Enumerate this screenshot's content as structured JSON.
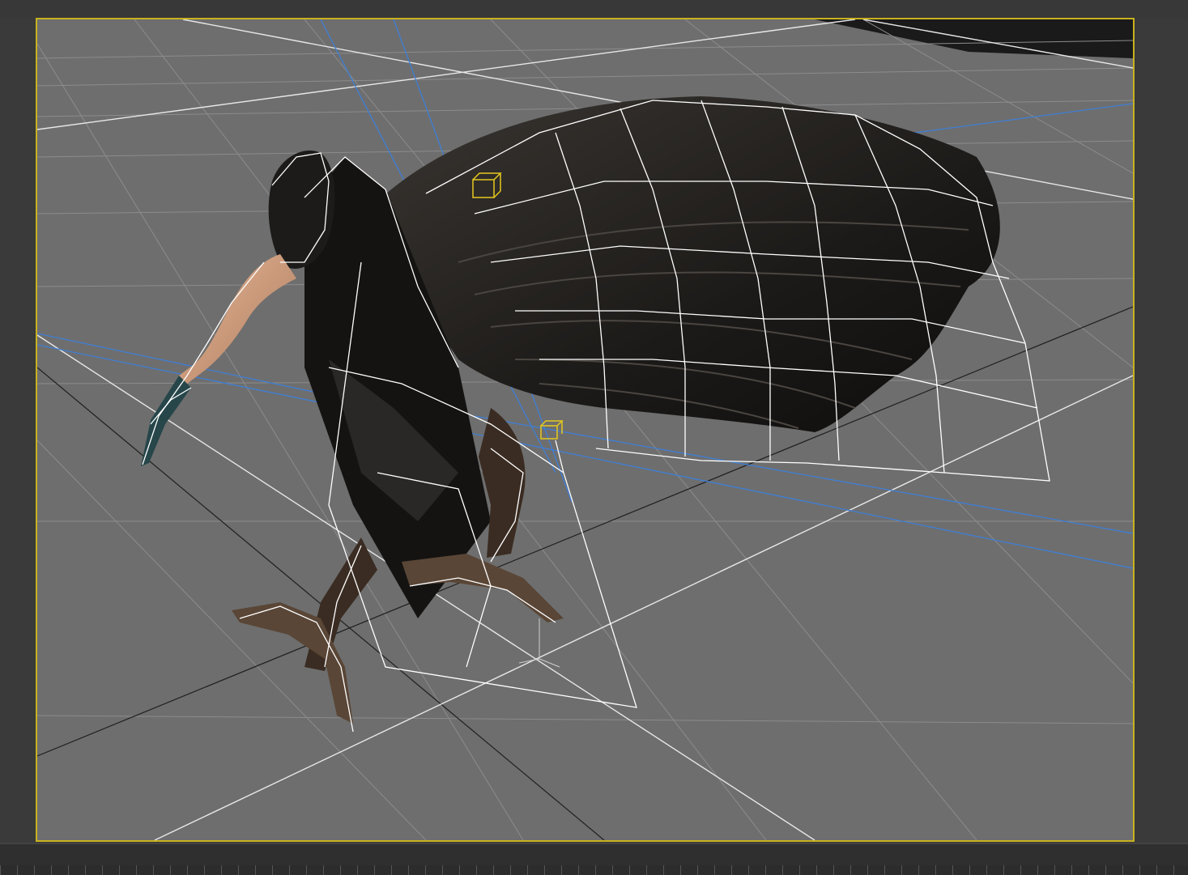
{
  "viewport": {
    "border_color": "#c9b21e",
    "background_color": "#6e6e6e",
    "grid_color": "#8a8a8a",
    "wireframe_color": "#ffffff",
    "light_beam_color": "#3f7fd6",
    "selection_color": "#e6c81e",
    "model_name": "",
    "view_label": ""
  },
  "icons": [
    "bone-helper-icon",
    "bone-helper-icon",
    "transform-gizmo-icon"
  ]
}
